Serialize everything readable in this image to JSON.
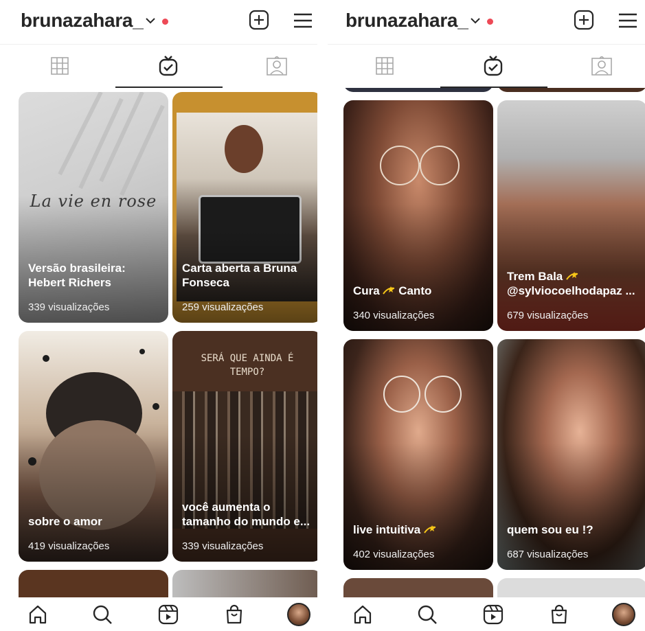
{
  "profile": {
    "username": "brunazahara_"
  },
  "icons": {
    "switch_account": "chevron-down-icon",
    "notification": "red-dot",
    "create": "plus-square-icon",
    "menu": "hamburger-menu-icon",
    "tab_grid": "grid-icon",
    "tab_igtv": "igtv-icon",
    "tab_tagged": "tagged-icon",
    "nav_home": "home-icon",
    "nav_search": "search-icon",
    "nav_reels": "reels-icon",
    "nav_shop": "shop-bag-icon",
    "nav_profile": "profile-avatar"
  },
  "colors": {
    "notification_dot": "#ed4956",
    "text": "#262626"
  },
  "left_panel": {
    "videos": [
      {
        "title": "Versão brasileira:\nHebert Richers",
        "views": "339 visualizações",
        "overlay_text": "La vie en rose"
      },
      {
        "title": "Carta aberta a Bruna\nFonseca",
        "views": "259 visualizações"
      },
      {
        "title": "sobre o amor",
        "views": "419 visualizações"
      },
      {
        "title": "você aumenta o\ntamanho do mundo e...",
        "views": "339 visualizações",
        "overlay_text": "SERÁ QUE AINDA É\nTEMPO?"
      }
    ]
  },
  "right_panel": {
    "videos": [
      {
        "title": "Cura",
        "title_after": "Canto",
        "views": "340 visualizações"
      },
      {
        "title": "Trem Bala",
        "title_line2": "@sylviocoelhodapaz ...",
        "views": "679 visualizações"
      },
      {
        "title": "live intuitiva",
        "views": "402 visualizações"
      },
      {
        "title": "quem sou eu !?",
        "views": "687 visualizações"
      }
    ]
  }
}
